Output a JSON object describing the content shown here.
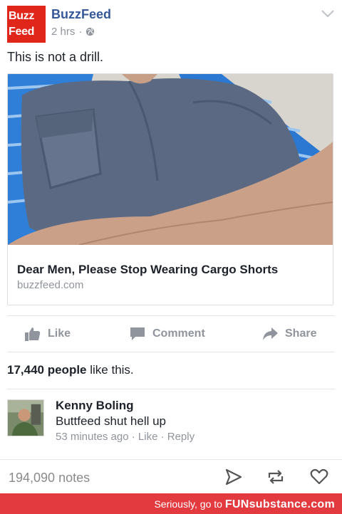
{
  "post": {
    "page_name": "BuzzFeed",
    "logo_line1": "Buzz",
    "logo_line2": "Feed",
    "time": "2 hrs",
    "separator": "·",
    "text": "This is not a drill."
  },
  "link": {
    "title": "Dear Men, Please Stop Wearing Cargo Shorts",
    "domain": "buzzfeed.com"
  },
  "actions": {
    "like": "Like",
    "comment": "Comment",
    "share": "Share"
  },
  "likes": {
    "count": "17,440 people",
    "suffix": " like this."
  },
  "comment": {
    "author": "Kenny Boling",
    "text": "Buttfeed shut hell up",
    "meta": "53 minutes ago · Like · Reply"
  },
  "tumblr": {
    "notes": "194,090 notes"
  },
  "footer": {
    "prefix": "Seriously, go to ",
    "brand": "FUNsubstance.com"
  },
  "colors": {
    "buzzfeed_red": "#e0251b",
    "link_blue": "#365899",
    "meta_gray": "#90949c",
    "footer_red": "#e23a3e"
  }
}
